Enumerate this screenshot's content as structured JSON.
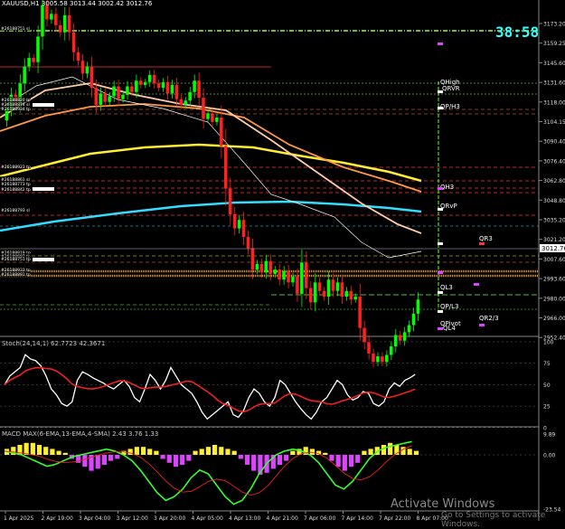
{
  "header": {
    "title": "XAUUSD,H1",
    "ohlc": "3005.58 3013.44 3002.42 3012.76",
    "timer": "38:58"
  },
  "price_axis": {
    "labels": [
      "3173.20",
      "3159.25",
      "3145.60",
      "3131.60",
      "3118.00",
      "3104.15",
      "3090.40",
      "3076.40",
      "3062.80",
      "3048.80",
      "3035.20",
      "3021.20",
      "3007.60",
      "2993.60",
      "2980.00",
      "2966.00",
      "2952.40"
    ],
    "current_price": "3012.76"
  },
  "time_axis": {
    "labels": [
      "1 Apr 2025",
      "2 Apr 19:00",
      "3 Apr 04:00",
      "3 Apr 12:00",
      "3 Apr 20:00",
      "4 Apr 05:00",
      "4 Apr 13:00",
      "4 Apr 21:00",
      "7 Apr 06:00",
      "7 Apr 14:00",
      "7 Apr 22:00",
      "8 Apr 07:00"
    ]
  },
  "levels": {
    "labels": [
      "QHigh",
      "QRVR",
      "QP/H3",
      "QH3",
      "QRvP",
      "QL3",
      "QP/L3",
      "QPivot",
      "QL4",
      "QR3",
      "QR2/3"
    ],
    "order_labels": [
      "#26188751 sl",
      "#26188820 tp",
      "#26188874 sl",
      "#26188934 tp",
      "#26188923 tp",
      "#26188861 sl",
      "#26188773 tp",
      "#26188842 tp",
      "#26188793 sl",
      "#26188819 tp",
      "#26188697 tp",
      "#26188751 tp",
      "#26188933 tp",
      "#26188891 tp"
    ]
  },
  "stoch": {
    "title": "Stoch(24,14,1) 62.7723 42.3671",
    "axis": [
      "100",
      "75",
      "50",
      "25",
      "0"
    ]
  },
  "macd": {
    "title": "MACD MAX(6-EMA,13-EMA,4-SMA) 2.43 3.76 1.33",
    "axis": [
      "9.89",
      "0.00",
      "-23.54"
    ]
  },
  "watermark": {
    "line1": "Activate Windows",
    "line2": "Go to Settings to activate Windows."
  },
  "colors": {
    "bull": "#00ff00",
    "bear": "#ff2020",
    "ma_yellow": "#ffee33",
    "ma_cyan": "#33ddff",
    "ma_orange": "#ff9944",
    "ma_peach": "#ffccaa",
    "pivot_magenta": "#dd44ff"
  }
}
